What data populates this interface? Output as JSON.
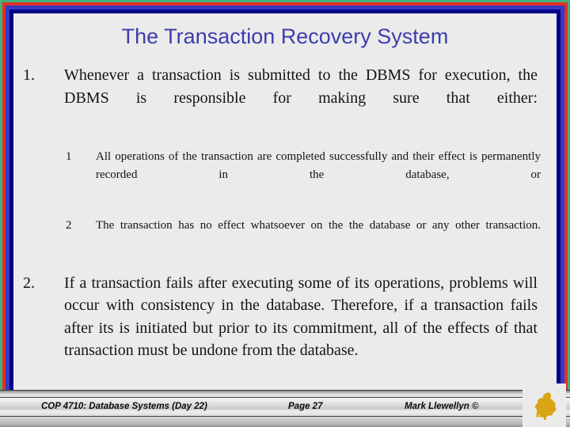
{
  "slide": {
    "title": "The Transaction Recovery System",
    "title_color": "#3d3dae",
    "background_color": "#ebebeb",
    "frame_colors": {
      "outer_green": "#45b07a",
      "red": "#e03127",
      "indigo": "#3838c4",
      "navy": "#020286"
    }
  },
  "body": {
    "items": [
      {
        "marker": "1.",
        "text": "Whenever a transaction is submitted to the DBMS for execution, the DBMS is responsible for making sure that either:"
      },
      {
        "marker": "2.",
        "text": "If a transaction fails after executing some of its operations, problems will occur with consistency in the database. Therefore, if a transaction fails after its is initiated but prior to its commitment, all of the effects of that transaction must be undone from the database."
      }
    ],
    "subitems": [
      {
        "marker": "1",
        "text": "All operations of the transaction are completed successfully and their effect is permanently recorded in the database, or"
      },
      {
        "marker": "2",
        "text": "The transaction has no effect whatsoever on the the database or any other transaction."
      }
    ]
  },
  "footer": {
    "course": "COP 4710: Database Systems  (Day 22)",
    "page": "Page 27",
    "author": "Mark Llewellyn ©",
    "logo_name": "ucf-pegasus-logo",
    "logo_color": "#d9a313"
  }
}
